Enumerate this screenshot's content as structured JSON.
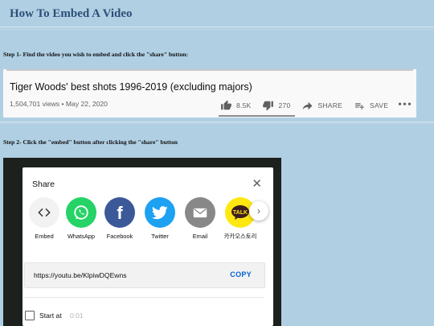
{
  "page": {
    "title": "How To Embed A Video",
    "step1": "Step 1- Find the video you wish to embed and click the \"share\" button:",
    "step2": "Step 2- Click the \"embed\" button after clicking the \"share\" button"
  },
  "video": {
    "title": "Tiger Woods' best shots 1996-2019 (excluding majors)",
    "meta": "1,504,701 views • May 22, 2020",
    "likes": "8.5K",
    "dislikes": "270",
    "share_label": "SHARE",
    "save_label": "SAVE",
    "more": "•••"
  },
  "share_dialog": {
    "title": "Share",
    "close": "✕",
    "targets": [
      {
        "label": "Embed",
        "icon": "embed-icon",
        "color": "#f2f2f2"
      },
      {
        "label": "WhatsApp",
        "icon": "whatsapp-icon",
        "color": "#25d366"
      },
      {
        "label": "Facebook",
        "icon": "facebook-icon",
        "color": "#3b5998"
      },
      {
        "label": "Twitter",
        "icon": "twitter-icon",
        "color": "#1da1f2"
      },
      {
        "label": "Email",
        "icon": "email-icon",
        "color": "#888888"
      },
      {
        "label": "카카오스토리",
        "icon": "kakaotalk-icon",
        "color": "#ffe812"
      }
    ],
    "next": "›",
    "url": "https://youtu.be/KlpiwDQEwns",
    "copy": "COPY",
    "start_at_label": "Start at",
    "start_at_time": "0:01"
  }
}
